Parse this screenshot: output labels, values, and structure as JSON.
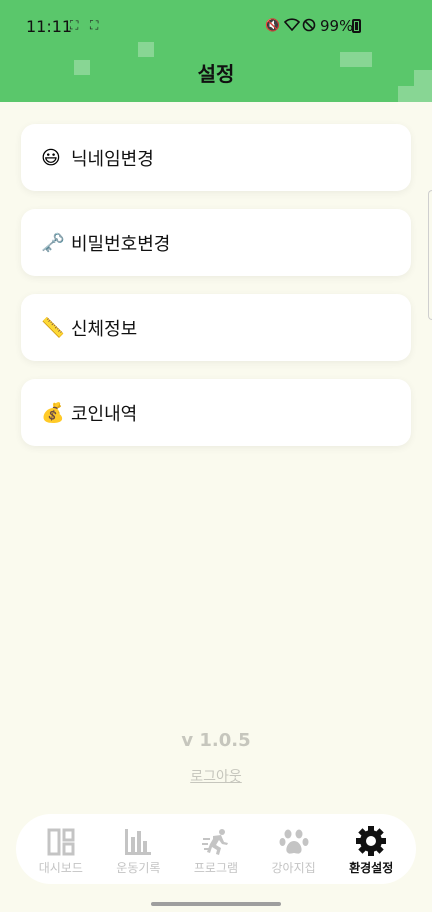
{
  "status_bar": {
    "time": "11:11",
    "battery": "99%"
  },
  "header": {
    "title": "설정"
  },
  "menu": {
    "items": [
      {
        "icon": "smiley-icon",
        "emoji": "😃",
        "label": "닉네임변경"
      },
      {
        "icon": "key-icon",
        "emoji": "🗝️",
        "label": "비밀번호변경"
      },
      {
        "icon": "ruler-icon",
        "emoji": "📏",
        "label": "신체정보"
      },
      {
        "icon": "money-bag-icon",
        "emoji": "💰",
        "label": "코인내역"
      }
    ]
  },
  "footer": {
    "version": "v 1.0.5",
    "logout": "로그아웃"
  },
  "bottom_nav": {
    "active_index": 4,
    "items": [
      {
        "icon": "dashboard-icon",
        "label": "대시보드"
      },
      {
        "icon": "bar-chart-icon",
        "label": "운동기록"
      },
      {
        "icon": "running-icon",
        "label": "프로그램"
      },
      {
        "icon": "paw-icon",
        "label": "강아지집"
      },
      {
        "icon": "gear-icon",
        "label": "환경설정"
      }
    ]
  },
  "colors": {
    "header_green": "#5ac76b",
    "background": "#fafaee",
    "inactive": "#c4c4c4"
  }
}
